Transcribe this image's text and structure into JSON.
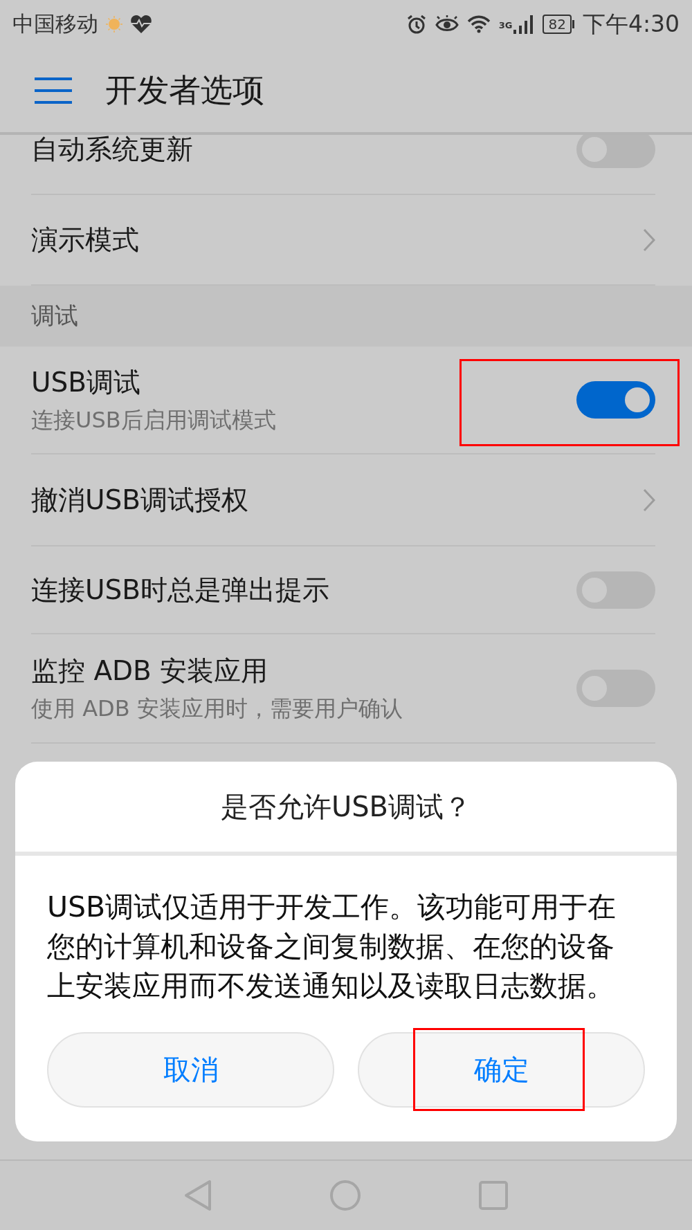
{
  "status_bar": {
    "carrier": "中国移动",
    "network": "3G",
    "battery": "82",
    "time": "下午4:30"
  },
  "app_bar": {
    "title": "开发者选项"
  },
  "settings": [
    {
      "kind": "toggle",
      "title": "自动系统更新",
      "on": false
    },
    {
      "kind": "link",
      "title": "演示模式"
    },
    {
      "kind": "header",
      "title": "调试"
    },
    {
      "kind": "toggle",
      "title": "USB调试",
      "subtitle": "连接USB后启用调试模式",
      "on": true,
      "highlighted": true
    },
    {
      "kind": "link",
      "title": "撤消USB调试授权"
    },
    {
      "kind": "toggle",
      "title": "连接USB时总是弹出提示",
      "on": false
    },
    {
      "kind": "toggle",
      "title": "监控 ADB 安装应用",
      "subtitle": "使用 ADB 安装应用时，需要用户确认",
      "on": false
    },
    {
      "kind": "spacer"
    }
  ],
  "dialog": {
    "title": "是否允许USB调试？",
    "message": "USB调试仅适用于开发工作。该功能可用于在您的计算机和设备之间复制数据、在您的设备上安装应用而不发送通知以及读取日志数据。",
    "buttons": [
      {
        "label": "取消",
        "highlighted": false
      },
      {
        "label": "确定",
        "highlighted": true
      }
    ]
  }
}
